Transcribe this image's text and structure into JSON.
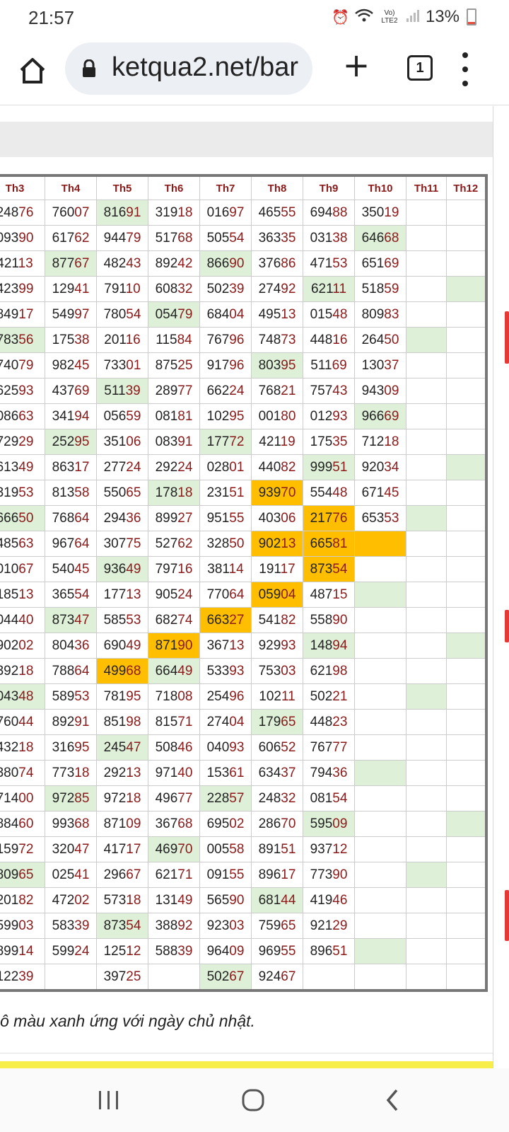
{
  "status": {
    "time": "21:57",
    "network": "Vo) LTE2",
    "battery": "13%"
  },
  "browser": {
    "url": "ketqua2.net/bar",
    "tab_count": "1"
  },
  "icons": {
    "home": "home-icon",
    "lock": "lock-icon",
    "new_tab": "plus-icon",
    "tabs": "tab-switcher-icon",
    "menu": "more-vert-icon",
    "alarm": "alarm-icon",
    "wifi": "wifi-icon",
    "signal": "signal-icon"
  },
  "colors": {
    "header_text": "#8b1a1a",
    "tail_digits": "#8b1a1a",
    "sunday_green": "#dff0d8",
    "highlight_orange": "#ffbf00"
  },
  "table": {
    "headers": [
      "Th3",
      "Th4",
      "Th5",
      "Th6",
      "Th7",
      "Th8",
      "Th9",
      "Th10",
      "Th11",
      "Th12"
    ],
    "rows": [
      [
        {
          "v": "24876"
        },
        {
          "v": "76007"
        },
        {
          "v": "81691",
          "h": "g"
        },
        {
          "v": "31918"
        },
        {
          "v": "01697"
        },
        {
          "v": "46555"
        },
        {
          "v": "69488"
        },
        {
          "v": "35019"
        },
        {
          "v": ""
        },
        {
          "v": ""
        }
      ],
      [
        {
          "v": "09390"
        },
        {
          "v": "61762"
        },
        {
          "v": "94479"
        },
        {
          "v": "51768"
        },
        {
          "v": "50554"
        },
        {
          "v": "36335"
        },
        {
          "v": "03138"
        },
        {
          "v": "64668",
          "h": "g"
        },
        {
          "v": ""
        },
        {
          "v": ""
        }
      ],
      [
        {
          "v": "42113"
        },
        {
          "v": "87767",
          "h": "g"
        },
        {
          "v": "48243"
        },
        {
          "v": "89242"
        },
        {
          "v": "86690",
          "h": "g"
        },
        {
          "v": "37686"
        },
        {
          "v": "47153"
        },
        {
          "v": "65169"
        },
        {
          "v": ""
        },
        {
          "v": ""
        }
      ],
      [
        {
          "v": "42399"
        },
        {
          "v": "12941"
        },
        {
          "v": "79110"
        },
        {
          "v": "60832"
        },
        {
          "v": "50239"
        },
        {
          "v": "27492"
        },
        {
          "v": "62111",
          "h": "g"
        },
        {
          "v": "51859"
        },
        {
          "v": ""
        },
        {
          "v": "",
          "h": "g"
        }
      ],
      [
        {
          "v": "84917"
        },
        {
          "v": "54997"
        },
        {
          "v": "78054"
        },
        {
          "v": "05479",
          "h": "g"
        },
        {
          "v": "68404"
        },
        {
          "v": "49513"
        },
        {
          "v": "01548"
        },
        {
          "v": "80983"
        },
        {
          "v": ""
        },
        {
          "v": ""
        }
      ],
      [
        {
          "v": "78356",
          "h": "g"
        },
        {
          "v": "17538"
        },
        {
          "v": "20116"
        },
        {
          "v": "11584"
        },
        {
          "v": "76796"
        },
        {
          "v": "74873"
        },
        {
          "v": "44816"
        },
        {
          "v": "26450"
        },
        {
          "v": "",
          "h": "g"
        },
        {
          "v": ""
        }
      ],
      [
        {
          "v": "74079"
        },
        {
          "v": "98245"
        },
        {
          "v": "73301"
        },
        {
          "v": "87525"
        },
        {
          "v": "91796"
        },
        {
          "v": "80395",
          "h": "g"
        },
        {
          "v": "51169"
        },
        {
          "v": "13037"
        },
        {
          "v": ""
        },
        {
          "v": ""
        }
      ],
      [
        {
          "v": "62593"
        },
        {
          "v": "43769"
        },
        {
          "v": "51139",
          "h": "g"
        },
        {
          "v": "28977"
        },
        {
          "v": "66224"
        },
        {
          "v": "76821"
        },
        {
          "v": "75743"
        },
        {
          "v": "94309"
        },
        {
          "v": ""
        },
        {
          "v": ""
        }
      ],
      [
        {
          "v": "08663"
        },
        {
          "v": "34194"
        },
        {
          "v": "05659"
        },
        {
          "v": "08181"
        },
        {
          "v": "10295"
        },
        {
          "v": "00180"
        },
        {
          "v": "01293"
        },
        {
          "v": "96669",
          "h": "g"
        },
        {
          "v": ""
        },
        {
          "v": ""
        }
      ],
      [
        {
          "v": "72929"
        },
        {
          "v": "25295",
          "h": "g"
        },
        {
          "v": "35106"
        },
        {
          "v": "08391"
        },
        {
          "v": "17772",
          "h": "g"
        },
        {
          "v": "42119"
        },
        {
          "v": "17535"
        },
        {
          "v": "71218"
        },
        {
          "v": ""
        },
        {
          "v": ""
        }
      ],
      [
        {
          "v": "61349"
        },
        {
          "v": "86317"
        },
        {
          "v": "27724"
        },
        {
          "v": "29224"
        },
        {
          "v": "02801"
        },
        {
          "v": "44082"
        },
        {
          "v": "99951",
          "h": "g"
        },
        {
          "v": "92034"
        },
        {
          "v": ""
        },
        {
          "v": "",
          "h": "g"
        }
      ],
      [
        {
          "v": "31953"
        },
        {
          "v": "81358"
        },
        {
          "v": "55065"
        },
        {
          "v": "17818",
          "h": "g"
        },
        {
          "v": "23151"
        },
        {
          "v": "93970",
          "h": "o"
        },
        {
          "v": "55448"
        },
        {
          "v": "67145"
        },
        {
          "v": ""
        },
        {
          "v": ""
        }
      ],
      [
        {
          "v": "66650",
          "h": "g"
        },
        {
          "v": "76864"
        },
        {
          "v": "29436"
        },
        {
          "v": "89927"
        },
        {
          "v": "95155"
        },
        {
          "v": "40306"
        },
        {
          "v": "21776",
          "h": "o"
        },
        {
          "v": "65353"
        },
        {
          "v": "",
          "h": "g"
        },
        {
          "v": ""
        }
      ],
      [
        {
          "v": "48563"
        },
        {
          "v": "96764"
        },
        {
          "v": "30775"
        },
        {
          "v": "52762"
        },
        {
          "v": "32850"
        },
        {
          "v": "90213",
          "h": "o"
        },
        {
          "v": "66581",
          "h": "o"
        },
        {
          "v": "",
          "h": "o"
        },
        {
          "v": ""
        },
        {
          "v": ""
        }
      ],
      [
        {
          "v": "01067"
        },
        {
          "v": "54045"
        },
        {
          "v": "93649",
          "h": "g"
        },
        {
          "v": "79716"
        },
        {
          "v": "38114"
        },
        {
          "v": "19117"
        },
        {
          "v": "87354",
          "h": "o"
        },
        {
          "v": ""
        },
        {
          "v": ""
        },
        {
          "v": ""
        }
      ],
      [
        {
          "v": "18513"
        },
        {
          "v": "36554"
        },
        {
          "v": "17713"
        },
        {
          "v": "90524"
        },
        {
          "v": "77064"
        },
        {
          "v": "05904",
          "h": "o"
        },
        {
          "v": "48715"
        },
        {
          "v": "",
          "h": "g"
        },
        {
          "v": ""
        },
        {
          "v": ""
        }
      ],
      [
        {
          "v": "04440"
        },
        {
          "v": "87347",
          "h": "g"
        },
        {
          "v": "58553"
        },
        {
          "v": "68274"
        },
        {
          "v": "66327",
          "h": "o"
        },
        {
          "v": "54182"
        },
        {
          "v": "55890"
        },
        {
          "v": ""
        },
        {
          "v": ""
        },
        {
          "v": ""
        }
      ],
      [
        {
          "v": "90202"
        },
        {
          "v": "80436"
        },
        {
          "v": "69049"
        },
        {
          "v": "87190",
          "h": "o"
        },
        {
          "v": "36713"
        },
        {
          "v": "92993"
        },
        {
          "v": "14894",
          "h": "g"
        },
        {
          "v": ""
        },
        {
          "v": ""
        },
        {
          "v": "",
          "h": "g"
        }
      ],
      [
        {
          "v": "39218"
        },
        {
          "v": "78864"
        },
        {
          "v": "49968",
          "h": "o"
        },
        {
          "v": "66449",
          "h": "g"
        },
        {
          "v": "53393"
        },
        {
          "v": "75303"
        },
        {
          "v": "62198"
        },
        {
          "v": ""
        },
        {
          "v": ""
        },
        {
          "v": ""
        }
      ],
      [
        {
          "v": "04348",
          "h": "g"
        },
        {
          "v": "58953"
        },
        {
          "v": "78195"
        },
        {
          "v": "71808"
        },
        {
          "v": "25496"
        },
        {
          "v": "10211"
        },
        {
          "v": "50221"
        },
        {
          "v": ""
        },
        {
          "v": "",
          "h": "g"
        },
        {
          "v": ""
        }
      ],
      [
        {
          "v": "76044"
        },
        {
          "v": "89291"
        },
        {
          "v": "85198"
        },
        {
          "v": "81571"
        },
        {
          "v": "27404"
        },
        {
          "v": "17965",
          "h": "g"
        },
        {
          "v": "44823"
        },
        {
          "v": ""
        },
        {
          "v": ""
        },
        {
          "v": ""
        }
      ],
      [
        {
          "v": "43218"
        },
        {
          "v": "31695"
        },
        {
          "v": "24547",
          "h": "g"
        },
        {
          "v": "50846"
        },
        {
          "v": "04093"
        },
        {
          "v": "60652"
        },
        {
          "v": "76777"
        },
        {
          "v": ""
        },
        {
          "v": ""
        },
        {
          "v": ""
        }
      ],
      [
        {
          "v": "38074"
        },
        {
          "v": "77318"
        },
        {
          "v": "29213"
        },
        {
          "v": "97140"
        },
        {
          "v": "15361"
        },
        {
          "v": "63437"
        },
        {
          "v": "79436"
        },
        {
          "v": "",
          "h": "g"
        },
        {
          "v": ""
        },
        {
          "v": ""
        }
      ],
      [
        {
          "v": "71400"
        },
        {
          "v": "97285",
          "h": "g"
        },
        {
          "v": "97218"
        },
        {
          "v": "49677"
        },
        {
          "v": "22857",
          "h": "g"
        },
        {
          "v": "24832"
        },
        {
          "v": "08154"
        },
        {
          "v": ""
        },
        {
          "v": ""
        },
        {
          "v": ""
        }
      ],
      [
        {
          "v": "88460"
        },
        {
          "v": "99368"
        },
        {
          "v": "87109"
        },
        {
          "v": "36768"
        },
        {
          "v": "69502"
        },
        {
          "v": "28670"
        },
        {
          "v": "59509",
          "h": "g"
        },
        {
          "v": ""
        },
        {
          "v": ""
        },
        {
          "v": "",
          "h": "g"
        }
      ],
      [
        {
          "v": "15972"
        },
        {
          "v": "32047"
        },
        {
          "v": "41717"
        },
        {
          "v": "46970",
          "h": "g"
        },
        {
          "v": "00558"
        },
        {
          "v": "89151"
        },
        {
          "v": "93712"
        },
        {
          "v": ""
        },
        {
          "v": ""
        },
        {
          "v": ""
        }
      ],
      [
        {
          "v": "80965",
          "h": "g"
        },
        {
          "v": "02541"
        },
        {
          "v": "29667"
        },
        {
          "v": "62171"
        },
        {
          "v": "09155"
        },
        {
          "v": "89617"
        },
        {
          "v": "77390"
        },
        {
          "v": ""
        },
        {
          "v": "",
          "h": "g"
        },
        {
          "v": ""
        }
      ],
      [
        {
          "v": "20182"
        },
        {
          "v": "47202"
        },
        {
          "v": "57318"
        },
        {
          "v": "13149"
        },
        {
          "v": "56590"
        },
        {
          "v": "68144",
          "h": "g"
        },
        {
          "v": "41946"
        },
        {
          "v": ""
        },
        {
          "v": ""
        },
        {
          "v": ""
        }
      ],
      [
        {
          "v": "59903"
        },
        {
          "v": "58339"
        },
        {
          "v": "87354",
          "h": "g"
        },
        {
          "v": "38892"
        },
        {
          "v": "92303"
        },
        {
          "v": "75965"
        },
        {
          "v": "92129"
        },
        {
          "v": ""
        },
        {
          "v": ""
        },
        {
          "v": ""
        }
      ],
      [
        {
          "v": "89914"
        },
        {
          "v": "59924"
        },
        {
          "v": "12512"
        },
        {
          "v": "58839"
        },
        {
          "v": "96409"
        },
        {
          "v": "96955"
        },
        {
          "v": "89651"
        },
        {
          "v": "",
          "h": "g"
        },
        {
          "v": ""
        },
        {
          "v": ""
        }
      ],
      [
        {
          "v": "12239"
        },
        {
          "v": ""
        },
        {
          "v": "39725"
        },
        {
          "v": ""
        },
        {
          "v": "50267",
          "h": "g"
        },
        {
          "v": "92467"
        },
        {
          "v": ""
        },
        {
          "v": ""
        },
        {
          "v": ""
        },
        {
          "v": ""
        }
      ]
    ]
  },
  "note": "ô màu xanh ứng với ngày chủ nhật."
}
